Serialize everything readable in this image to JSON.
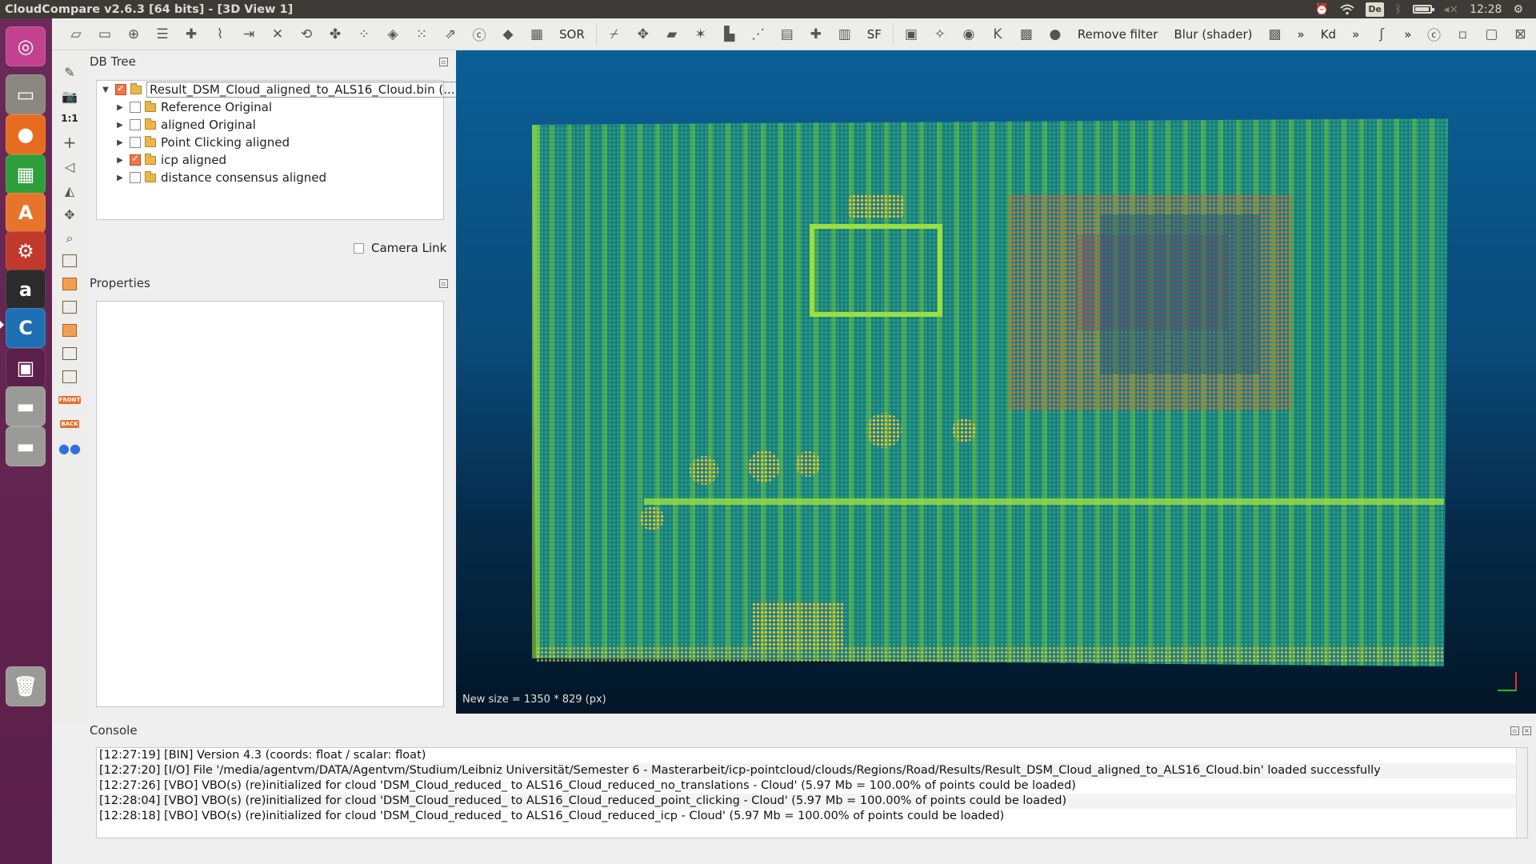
{
  "window": {
    "title": "CloudCompare v2.6.3 [64 bits] - [3D View 1]"
  },
  "tray": {
    "keyboard": "De",
    "clock": "12:28",
    "battery_level": 0.85
  },
  "launcher": {
    "items": [
      {
        "name": "ubuntu-home-icon",
        "glyph": "◎",
        "color": "#c2428f"
      },
      {
        "name": "files-icon",
        "glyph": "▭",
        "color": "#8a8780"
      },
      {
        "name": "firefox-icon",
        "glyph": "●",
        "color": "#e76c1f"
      },
      {
        "name": "libreoffice-calc-icon",
        "glyph": "▦",
        "color": "#2e9e3a"
      },
      {
        "name": "software-center-icon",
        "glyph": "A",
        "color": "#e8742b"
      },
      {
        "name": "system-settings-icon",
        "glyph": "⚙",
        "color": "#c0392b"
      },
      {
        "name": "amazon-icon",
        "glyph": "a",
        "color": "#2b2b2b"
      },
      {
        "name": "cloudcompare-icon",
        "glyph": "C",
        "color": "#1f6fb5"
      },
      {
        "name": "workspace-switcher-icon",
        "glyph": "▣",
        "color": "#5b1f4b"
      },
      {
        "name": "drive-icon-1",
        "glyph": "▬",
        "color": "#9a9a96"
      },
      {
        "name": "drive-icon-2",
        "glyph": "▬",
        "color": "#9a9a96"
      },
      {
        "name": "trash-icon",
        "glyph": "🗑",
        "color": "#9a9a96"
      }
    ]
  },
  "toolbar": {
    "buttons": [
      "open-icon",
      "save-icon",
      "translate-rotate-icon",
      "list-icon",
      "add-point-icon",
      "segment-icon",
      "merge-icon",
      "delete-icon",
      "clone-icon",
      "sample-icon",
      "subsample-icon",
      "mesh-icon",
      "noise-icon",
      "normals-icon",
      "cc-icon",
      "color-icon",
      "checkerboard-icon"
    ],
    "sor_label": "SOR",
    "buttons2": [
      "pick-icon",
      "move-icon",
      "plane-icon",
      "star-icon",
      "histogram-icon",
      "stats-icon",
      "filter-icon",
      "cross-icon",
      "calc-icon"
    ],
    "sf_label": "SF",
    "buttons3": [
      "film-icon",
      "camera-icon",
      "capture-icon",
      "k-icon",
      "map-icon",
      "circle-icon"
    ],
    "remove_filter": "Remove filter",
    "blur_shader": "Blur (shader)",
    "more": "»",
    "kd": "Kd"
  },
  "vstrip": {
    "one_to_one": "1:1",
    "front": "FRONT",
    "back": "BACK"
  },
  "dbtree": {
    "title": "DB Tree",
    "root": {
      "label": "Result_DSM_Cloud_aligned_to_ALS16_Cloud.bin (...",
      "checked": true
    },
    "children": [
      {
        "label": "Reference Original",
        "checked": false
      },
      {
        "label": "aligned Original",
        "checked": false
      },
      {
        "label": "Point Clicking aligned",
        "checked": false
      },
      {
        "label": "icp aligned",
        "checked": true
      },
      {
        "label": "distance consensus aligned",
        "checked": false
      }
    ],
    "camera_link": "Camera Link"
  },
  "properties": {
    "title": "Properties"
  },
  "view3d": {
    "new_size": "New size = 1350 * 829 (px)"
  },
  "console": {
    "title": "Console",
    "lines": [
      "[12:27:19] [BIN] Version 4.3 (coords: float / scalar: float)",
      "[12:27:20] [I/O] File '/media/agentvm/DATA/Agentvm/Studium/Leibniz Universität/Semester 6 - Masterarbeit/icp-pointcloud/clouds/Regions/Road/Results/Result_DSM_Cloud_aligned_to_ALS16_Cloud.bin' loaded successfully",
      "[12:27:26] [VBO] VBO(s) (re)initialized for cloud 'DSM_Cloud_reduced_ to ALS16_Cloud_reduced_no_translations - Cloud' (5.97 Mb = 100.00% of points could be loaded)",
      "[12:28:04] [VBO] VBO(s) (re)initialized for cloud 'DSM_Cloud_reduced_ to ALS16_Cloud_reduced_point_clicking - Cloud' (5.97 Mb = 100.00% of points could be loaded)",
      "[12:28:18] [VBO] VBO(s) (re)initialized for cloud 'DSM_Cloud_reduced_ to ALS16_Cloud_reduced_icp - Cloud' (5.97 Mb = 100.00% of points could be loaded)"
    ]
  },
  "colors": {
    "accent": "#f07746",
    "launcher": "#6b2a57",
    "topbar": "#3c3b37",
    "view_top": "#0a5f97",
    "view_bottom": "#021626"
  }
}
